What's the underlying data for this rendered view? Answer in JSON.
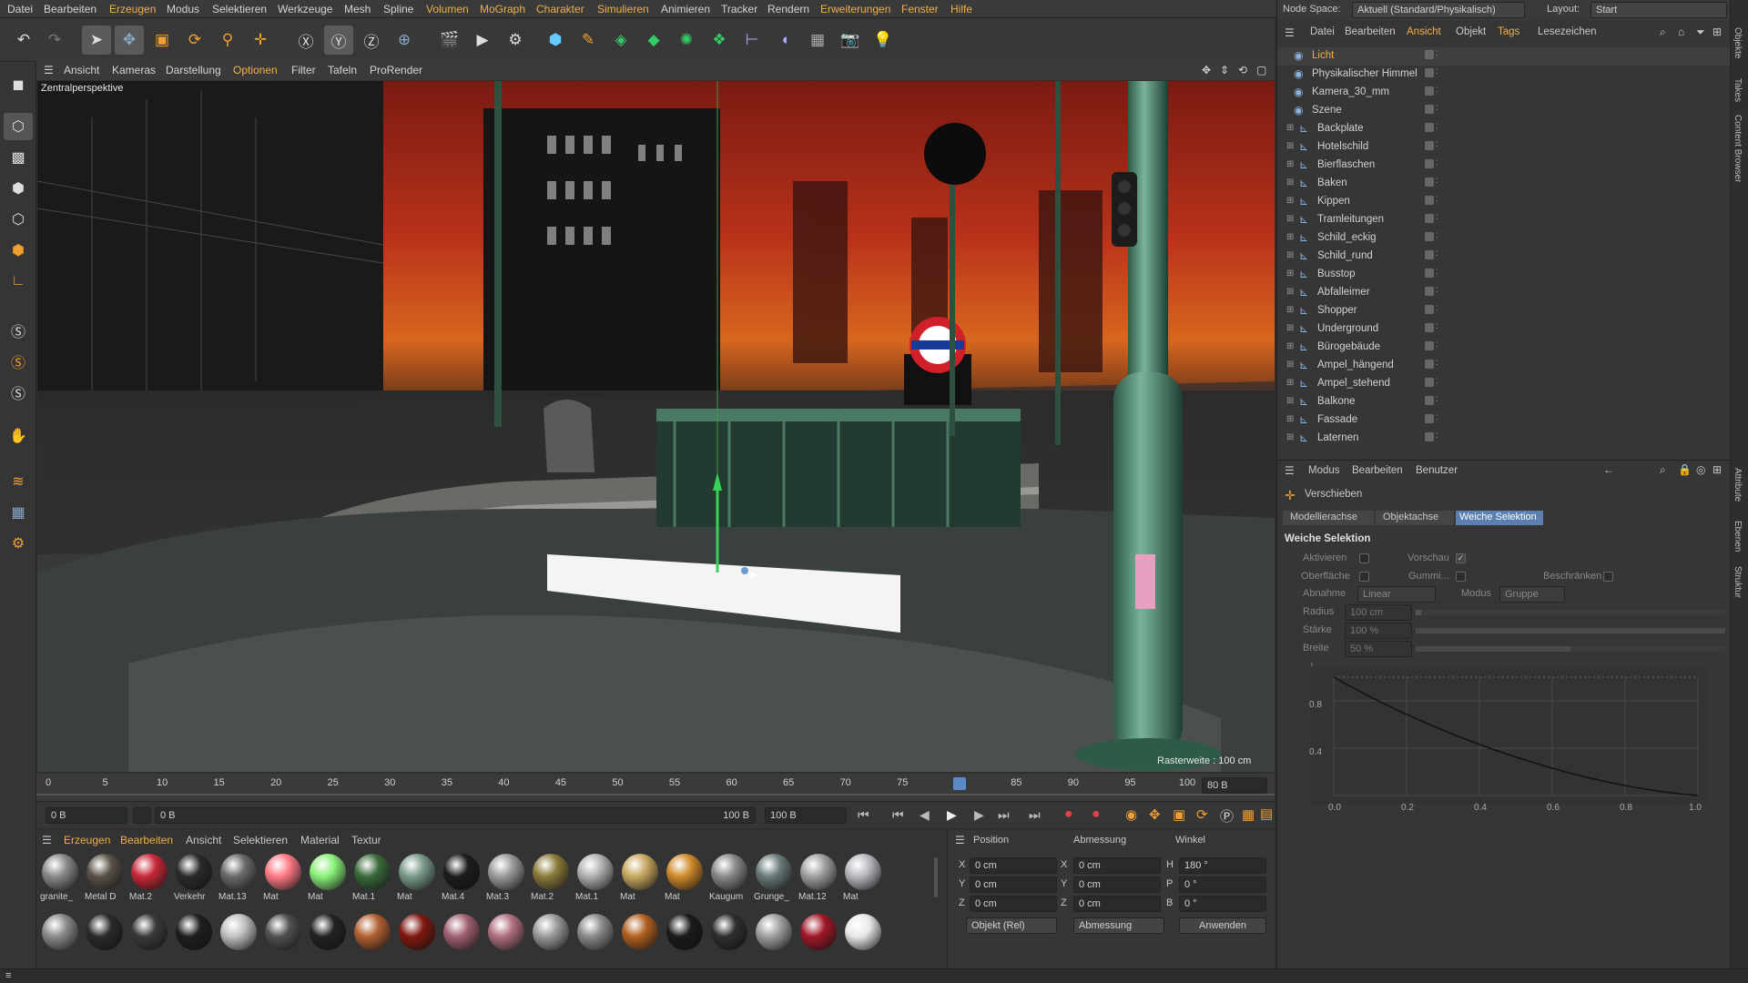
{
  "menubar": {
    "items": [
      "Datei",
      "Bearbeiten",
      "Erzeugen",
      "Modus",
      "Selektieren",
      "Werkzeuge",
      "Mesh",
      "Spline",
      "Volumen",
      "MoGraph",
      "Charakter",
      "Simulieren",
      "Tracker",
      "Animieren",
      "Rendern",
      "Erweiterungen",
      "Fenster",
      "Hilfe"
    ],
    "node_space_label": "Node Space:",
    "node_space_value": "Aktuell (Standard/Physikalisch)",
    "layout_label": "Layout:",
    "layout_value": "Start"
  },
  "viewport_menu": {
    "items": [
      "Ansicht",
      "Kameras",
      "Darstellung",
      "Optionen",
      "Filter",
      "Tafeln",
      "ProRender"
    ],
    "active": "Optionen",
    "view_name": "Zentralperspektive",
    "grid_info": "Rasterweite : 100 cm"
  },
  "timeline": {
    "ticks": [
      "0",
      "5",
      "10",
      "15",
      "20",
      "25",
      "30",
      "35",
      "40",
      "45",
      "50",
      "55",
      "60",
      "65",
      "70",
      "75",
      "80",
      "85",
      "90",
      "95",
      "100"
    ],
    "current_frame": "80 B",
    "playhead_frame": 80,
    "start_field": "0 B",
    "start_field2": "0 B",
    "end_field": "100 B",
    "end_field2": "100 B"
  },
  "material_panel": {
    "menu": [
      "Erzeugen",
      "Bearbeiten",
      "Ansicht",
      "Selektieren",
      "Material",
      "Textur"
    ],
    "row1": [
      {
        "label": "granite_",
        "color": "#8a8a8a"
      },
      {
        "label": "Metal D",
        "color": "#5a5248"
      },
      {
        "label": "Mat.2",
        "color": "#c8283a"
      },
      {
        "label": "Verkehr",
        "color": "#2a2a2a"
      },
      {
        "label": "Mat.13",
        "color": "#6a6a6a"
      },
      {
        "label": "Mat",
        "color": "#ff7a85"
      },
      {
        "label": "Mat",
        "color": "#8af07a"
      },
      {
        "label": "Mat.1",
        "color": "#3a6a3a"
      },
      {
        "label": "Mat",
        "color": "#7a9a8a"
      },
      {
        "label": "Mat.4",
        "color": "#1c1c1c"
      },
      {
        "label": "Mat.3",
        "color": "#9a9a9a"
      },
      {
        "label": "Mat.2",
        "color": "#8a7a3a"
      },
      {
        "label": "Mat.1",
        "color": "#b0b0b0"
      },
      {
        "label": "Mat",
        "color": "#c8a860"
      },
      {
        "label": "Mat",
        "color": "#d08a2a"
      },
      {
        "label": "Kaugum",
        "color": "#8a8a8a"
      },
      {
        "label": "Grunge_",
        "color": "#6a7a7a"
      },
      {
        "label": "Mat.12",
        "color": "#a0a0a0"
      },
      {
        "label": "Mat",
        "color": "#b8b8c0"
      }
    ],
    "row2_colors": [
      "#8a8a8a",
      "#2a2a2a",
      "#3a3a3a",
      "#1e1e1e",
      "#c0c0c0",
      "#505050",
      "#222222",
      "#b06030",
      "#801810",
      "#a06070",
      "#b07080",
      "#9a9a9a",
      "#8a8a8a",
      "#b06020",
      "#1a1a1a",
      "#2e2e2e",
      "#a0a0a0",
      "#a01828",
      "#e8e8e8"
    ]
  },
  "coords": {
    "headers": [
      "Position",
      "Abmessung",
      "Winkel"
    ],
    "rows": [
      {
        "axis": "X",
        "pos": "0 cm",
        "axis2": "X",
        "size": "0 cm",
        "axis3": "H",
        "angle": "180 °"
      },
      {
        "axis": "Y",
        "pos": "0 cm",
        "axis2": "Y",
        "size": "0 cm",
        "axis3": "P",
        "angle": "0 °"
      },
      {
        "axis": "Z",
        "pos": "0 cm",
        "axis2": "Z",
        "size": "0 cm",
        "axis3": "B",
        "angle": "0 °"
      }
    ],
    "mode1": "Objekt (Rel)",
    "mode2": "Abmessung",
    "apply": "Anwenden"
  },
  "objects_panel": {
    "menu": [
      "Datei",
      "Bearbeiten",
      "Ansicht",
      "Objekt",
      "Tags",
      "Lesezeichen"
    ],
    "active_menu": "Ansicht",
    "rows": [
      {
        "name": "Licht",
        "selected": true,
        "indent": 0
      },
      {
        "name": "Physikalischer Himmel",
        "indent": 0
      },
      {
        "name": "Kamera_30_mm",
        "indent": 0
      },
      {
        "name": "Szene",
        "indent": 0
      },
      {
        "name": "Backplate",
        "indent": 1
      },
      {
        "name": "Hotelschild",
        "indent": 1
      },
      {
        "name": "Bierflaschen",
        "indent": 1
      },
      {
        "name": "Baken",
        "indent": 1
      },
      {
        "name": "Kippen",
        "indent": 1
      },
      {
        "name": "Tramleitungen",
        "indent": 1
      },
      {
        "name": "Schild_eckig",
        "indent": 1
      },
      {
        "name": "Schild_rund",
        "indent": 1
      },
      {
        "name": "Busstop",
        "indent": 1
      },
      {
        "name": "Abfalleimer",
        "indent": 1
      },
      {
        "name": "Shopper",
        "indent": 1
      },
      {
        "name": "Underground",
        "indent": 1
      },
      {
        "name": "Bürogebäude",
        "indent": 1
      },
      {
        "name": "Ampel_hängend",
        "indent": 1
      },
      {
        "name": "Ampel_stehend",
        "indent": 1
      },
      {
        "name": "Balkone",
        "indent": 1
      },
      {
        "name": "Fassade",
        "indent": 1
      },
      {
        "name": "Laternen",
        "indent": 1
      }
    ]
  },
  "attributes": {
    "menu": [
      "Modus",
      "Bearbeiten",
      "Benutzer"
    ],
    "tool_name": "Verschieben",
    "tabs": [
      "Modellierachse",
      "Objektachse",
      "Weiche Selektion"
    ],
    "active_tab": "Weiche Selektion",
    "section": "Weiche Selektion",
    "aktivieren": "Aktivieren",
    "vorschau": "Vorschau",
    "oberflaeche": "Oberfläche",
    "gummi": "Gummi...",
    "beschraenken": "Beschränken",
    "abnahme_label": "Abnahme",
    "abnahme_value": "Linear",
    "modus_label": "Modus",
    "modus_value": "Gruppe",
    "radius_label": "Radius",
    "radius_value": "100 cm",
    "staerke_label": "Stärke",
    "staerke_value": "100 %",
    "breite_label": "Breite",
    "breite_value": "50 %",
    "graph_x": [
      "0.0",
      "0.2",
      "0.4",
      "0.6",
      "0.8",
      "1.0"
    ],
    "graph_y": [
      "0.8",
      "0.4"
    ]
  },
  "side_tabs": [
    "Objekte",
    "Takes",
    "Content Browser",
    "Attribute",
    "Ebenen",
    "Struktur"
  ]
}
